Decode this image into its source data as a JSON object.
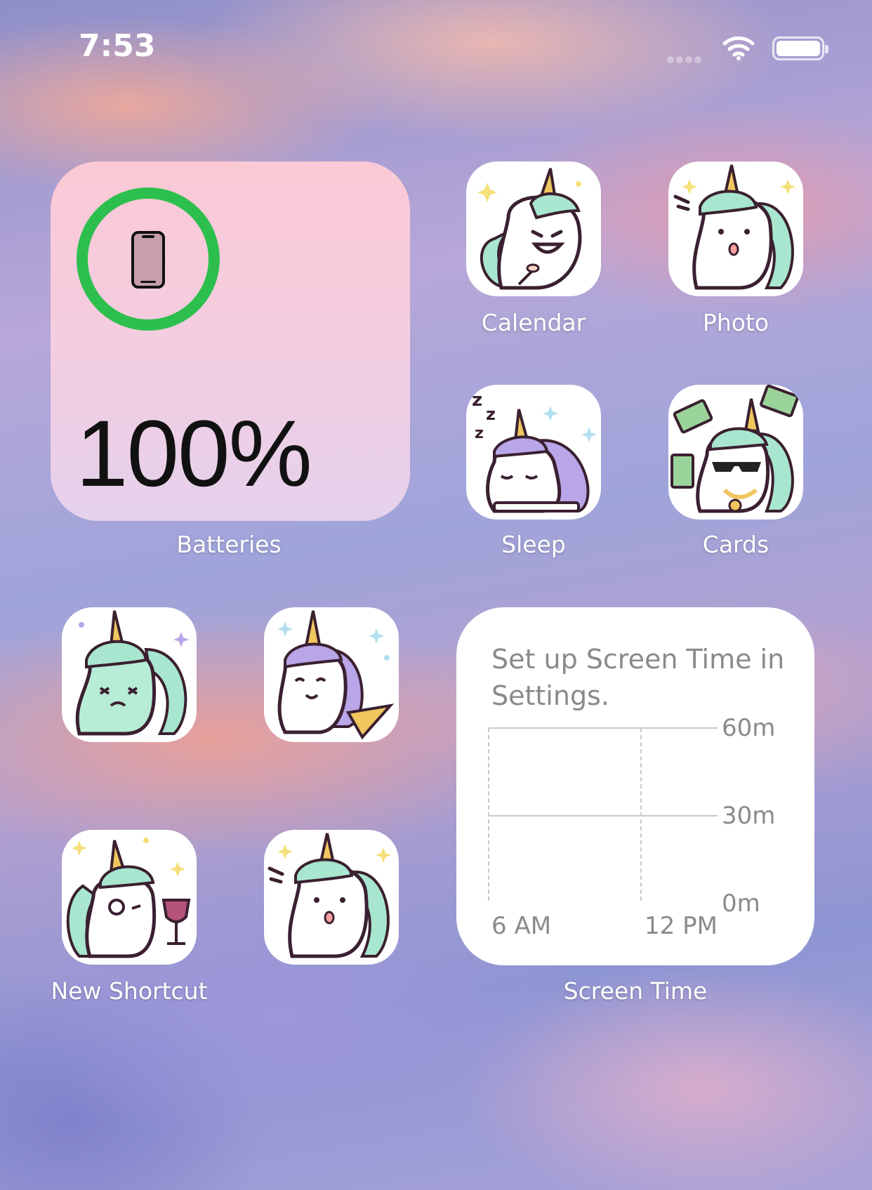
{
  "status_bar": {
    "time": "7:53"
  },
  "battery_widget": {
    "percent": "100%",
    "level": 1.0,
    "ring_color": "#2dbf4e",
    "label": "Batteries"
  },
  "apps": [
    {
      "label": "Calendar",
      "icon": "unicorn-laughing-icon"
    },
    {
      "label": "Photo",
      "icon": "unicorn-surprised-icon"
    },
    {
      "label": "Sleep",
      "icon": "unicorn-sleeping-icon"
    },
    {
      "label": "Cards",
      "icon": "unicorn-money-icon"
    },
    {
      "label": "",
      "icon": "unicorn-sick-icon"
    },
    {
      "label": "",
      "icon": "unicorn-pizza-icon"
    },
    {
      "label": "New Shortcut",
      "icon": "unicorn-monocle-wine-icon"
    },
    {
      "label": "",
      "icon": "unicorn-surprised-icon"
    }
  ],
  "screen_time_widget": {
    "message": "Set up Screen Time in Settings.",
    "label": "Screen Time",
    "y_ticks": [
      "60m",
      "30m",
      "0m"
    ],
    "x_ticks": [
      "6 AM",
      "12 PM"
    ]
  },
  "colors": {
    "label_text": "#ffffff",
    "mane_mint": "#a8e6cf",
    "mane_purple": "#b9a6e8",
    "horn_gold": "#f0c75e",
    "outline": "#3a2030"
  }
}
